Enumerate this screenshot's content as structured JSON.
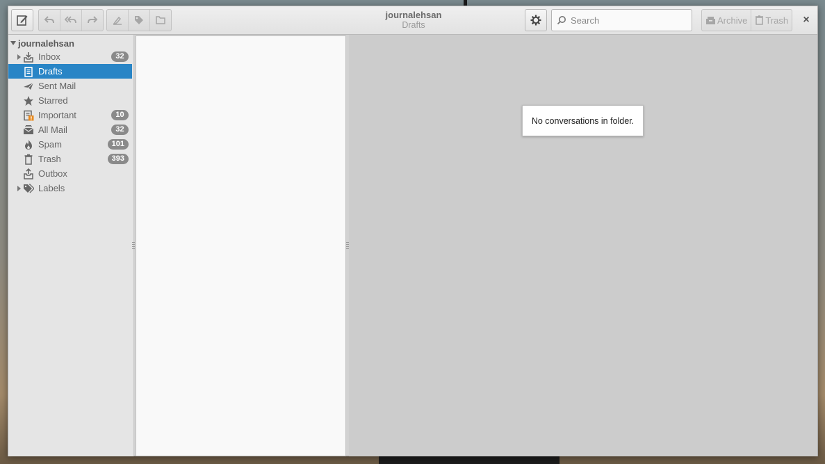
{
  "window": {
    "title": "journalehsan",
    "subtitle": "Drafts"
  },
  "toolbar": {
    "compose_icon": "compose-icon",
    "reply_icon": "reply-icon",
    "reply_all_icon": "reply-all-icon",
    "forward_icon": "forward-icon",
    "mark_icon": "mark-icon",
    "label_icon": "tag-icon",
    "move_icon": "folder-icon",
    "settings_icon": "gear-icon",
    "archive_label": "Archive",
    "trash_label": "Trash",
    "close_glyph": "×"
  },
  "search": {
    "placeholder": "Search",
    "value": ""
  },
  "sidebar": {
    "account": "journalehsan",
    "folders": [
      {
        "label": "Inbox",
        "badge": "32",
        "icon": "inbox-icon",
        "expandable": true
      },
      {
        "label": "Drafts",
        "badge": "",
        "icon": "drafts-icon",
        "selected": true
      },
      {
        "label": "Sent Mail",
        "badge": "",
        "icon": "sent-icon"
      },
      {
        "label": "Starred",
        "badge": "",
        "icon": "star-icon"
      },
      {
        "label": "Important",
        "badge": "10",
        "icon": "important-icon"
      },
      {
        "label": "All Mail",
        "badge": "32",
        "icon": "all-mail-icon"
      },
      {
        "label": "Spam",
        "badge": "101",
        "icon": "spam-icon"
      },
      {
        "label": "Trash",
        "badge": "393",
        "icon": "trash-icon"
      },
      {
        "label": "Outbox",
        "badge": "",
        "icon": "outbox-icon"
      },
      {
        "label": "Labels",
        "badge": "",
        "icon": "labels-icon",
        "expandable": true
      }
    ]
  },
  "preview": {
    "empty_message": "No conversations in folder."
  },
  "colors": {
    "selection": "#2985c6",
    "badge": "#8a8a8a",
    "important_accent": "#e8891d"
  }
}
